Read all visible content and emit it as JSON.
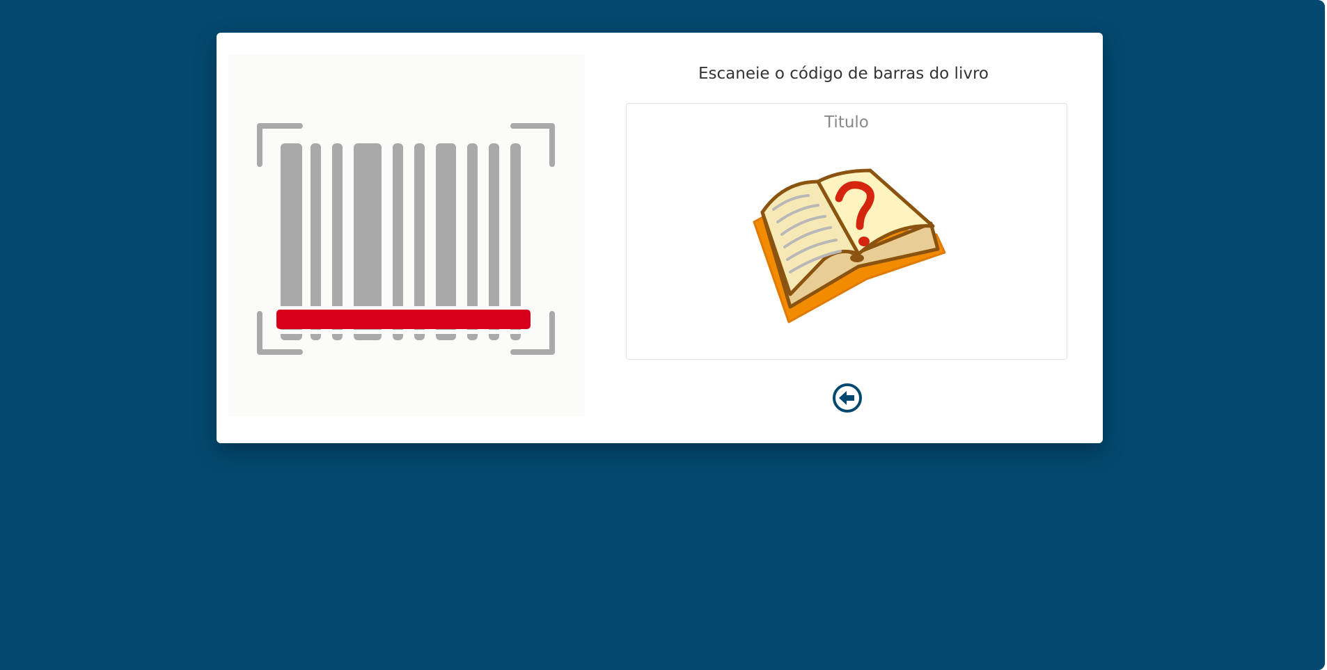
{
  "scan_prompt": "Escaneie o código de barras do livro",
  "book": {
    "title": "Titulo"
  },
  "icons": {
    "barcode_scan": "barcode-scan-icon",
    "book_unknown": "open-book-question-icon",
    "back": "arrow-circle-left-icon"
  },
  "colors": {
    "background": "#03486f",
    "card": "#ffffff",
    "scan_line": "#d6001c",
    "barcode": "#a9a9a9",
    "back_icon": "#03486f"
  }
}
